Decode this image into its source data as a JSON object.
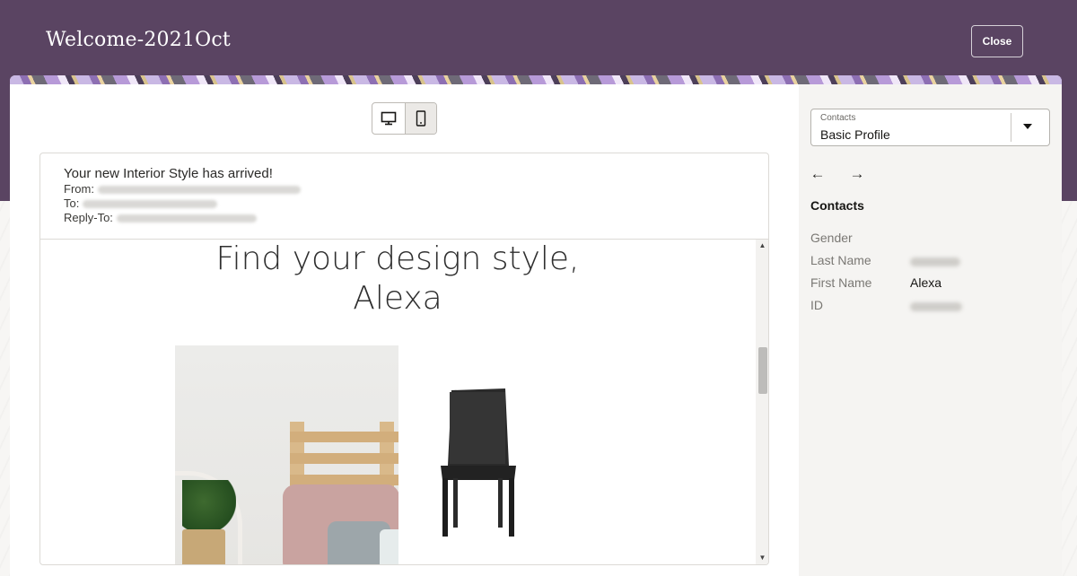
{
  "window": {
    "title": "Welcome-2021Oct",
    "close_label": "Close"
  },
  "preview": {
    "toggle": {
      "desktop_icon": "desktop-icon",
      "mobile_icon": "mobile-icon",
      "selected": "mobile"
    },
    "email": {
      "subject": "Your new Interior Style has arrived!",
      "from_label": "From:",
      "to_label": "To:",
      "reply_to_label": "Reply-To:",
      "headline_line1": "Find your design style,",
      "headline_line2": "Alexa"
    }
  },
  "side_panel": {
    "select": {
      "label": "Contacts",
      "value": "Basic Profile"
    },
    "nav": {
      "back_icon": "arrow-left-icon",
      "forward_icon": "arrow-right-icon"
    },
    "section_title": "Contacts",
    "fields": [
      {
        "label": "Gender",
        "value": ""
      },
      {
        "label": "Last Name",
        "value": ""
      },
      {
        "label": "First Name",
        "value": "Alexa"
      },
      {
        "label": "ID",
        "value": ""
      }
    ]
  },
  "colors": {
    "header": "#5a4462",
    "panel": "#f5f4f2"
  }
}
